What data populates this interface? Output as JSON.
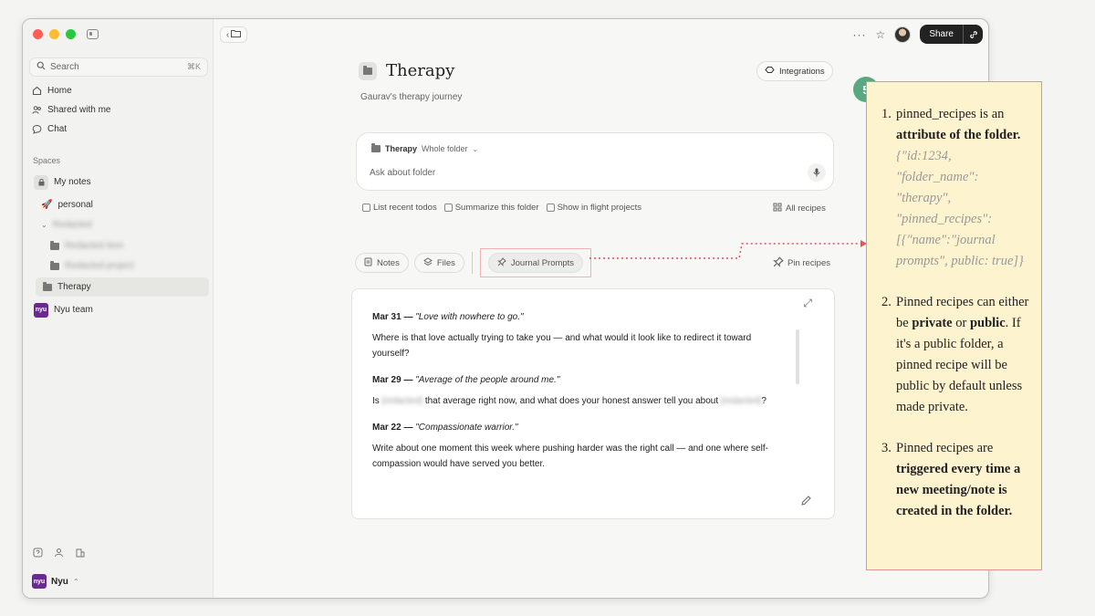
{
  "window": {
    "traffic_colors": [
      "#ff5f57",
      "#febc2e",
      "#28c840"
    ]
  },
  "sidebar": {
    "search_placeholder": "Search",
    "search_shortcut": "⌘K",
    "nav": [
      {
        "label": "Home",
        "icon": "home-icon"
      },
      {
        "label": "Shared with me",
        "icon": "people-icon"
      },
      {
        "label": "Chat",
        "icon": "chat-icon"
      }
    ],
    "spaces_label": "Spaces",
    "spaces": [
      {
        "label": "My notes",
        "icon": "lock-icon"
      },
      {
        "label": "personal",
        "icon": "rocket-icon"
      },
      {
        "label": "Redacted",
        "icon": "chevron-down-icon",
        "blurred": true
      },
      {
        "label": "Redacted item",
        "icon": "folder-icon",
        "blurred": true
      },
      {
        "label": "Redacted project",
        "icon": "folder-icon",
        "blurred": true
      },
      {
        "label": "Therapy",
        "icon": "folder-icon",
        "active": true
      }
    ],
    "team_label": "Nyu team",
    "team_icon_text": "nyu",
    "footer_label": "Nyu",
    "footer_chevron": "⌃"
  },
  "topbar": {
    "more_label": "···",
    "share_label": "Share"
  },
  "page": {
    "title": "Therapy",
    "subtitle": "Gaurav's therapy journey",
    "integrations_label": "Integrations"
  },
  "ask": {
    "folder_label": "Therapy",
    "scope_label": "Whole folder",
    "placeholder": "Ask about folder"
  },
  "suggestions": [
    "List recent todos",
    "Summarize this folder",
    "Show in flight projects"
  ],
  "all_recipes_label": "All recipes",
  "tabs": {
    "notes": "Notes",
    "files": "Files",
    "journal": "Journal Prompts",
    "pin_recipes": "Pin recipes"
  },
  "journal": {
    "entries": [
      {
        "date": "Mar 31",
        "sep": " — ",
        "quote": "\"Love with nowhere to go.\"",
        "text": "Where is that love actually trying to take you — and what would it look like to redirect it toward yourself?"
      },
      {
        "date": "Mar 29",
        "sep": " — ",
        "quote": "\"Average of the people around me.\"",
        "text_pre": "Is",
        "text_blur": "[redacted]",
        "text_mid": "that average right now, and what does your honest answer tell you about",
        "text_blur2": "[redacted]",
        "text_post": "?"
      },
      {
        "date": "Mar 22",
        "sep": " — ",
        "quote": "\"Compassionate warrior.\"",
        "text": "Write about one moment this week where pushing harder was the right call — and one where self-compassion would have served you better."
      }
    ]
  },
  "annotation": {
    "step": "5",
    "accent": "#5aa882",
    "items": [
      {
        "num": "1.",
        "pre": "pinned_recipes is an ",
        "bold": "attribute of the folder.",
        "code": "{\"id:1234, \"folder_name\": \"therapy\", \"pinned_recipes\": [{\"name\":\"journal prompts\", public: true]}"
      },
      {
        "num": "2.",
        "pre": "Pinned recipes can either be ",
        "bold1": "private",
        "mid": " or ",
        "bold2": "public",
        "post": ". If it's a public folder, a pinned recipe will be public by default unless made private."
      },
      {
        "num": "3.",
        "pre": "Pinned recipes are ",
        "bold": "triggered every time a new meeting/note is created in the folder."
      }
    ]
  }
}
